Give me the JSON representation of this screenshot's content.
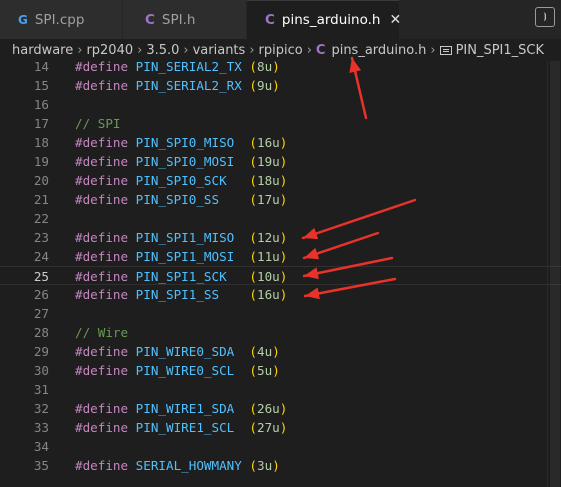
{
  "tabs": [
    {
      "label": "SPI.cpp",
      "icon": "G",
      "icon_name": "cpp-file-icon"
    },
    {
      "label": "SPI.h",
      "icon": "C",
      "icon_name": "c-header-file-icon"
    },
    {
      "label": "pins_arduino.h",
      "icon": "C",
      "icon_name": "c-header-file-icon",
      "active": true,
      "close_glyph": "✕"
    }
  ],
  "split_button": {
    "glyph": "⦘",
    "icon_name": "split-editor-icon"
  },
  "breadcrumb": {
    "parts": [
      "hardware",
      "rp2040",
      "3.5.0",
      "variants",
      "rpipico"
    ],
    "file": "pins_arduino.h",
    "file_icon": "C",
    "symbol": "PIN_SPI1_SCK",
    "separator": "›"
  },
  "code_lines": [
    {
      "n": "14",
      "kw": "#define",
      "id": "PIN_SERIAL2_TX",
      "gap": " ",
      "val": "8u"
    },
    {
      "n": "15",
      "kw": "#define",
      "id": "PIN_SERIAL2_RX",
      "gap": " ",
      "val": "9u"
    },
    {
      "n": "16"
    },
    {
      "n": "17",
      "comment": "// SPI"
    },
    {
      "n": "18",
      "kw": "#define",
      "id": "PIN_SPI0_MISO",
      "gap": "  ",
      "val": "16u"
    },
    {
      "n": "19",
      "kw": "#define",
      "id": "PIN_SPI0_MOSI",
      "gap": "  ",
      "val": "19u"
    },
    {
      "n": "20",
      "kw": "#define",
      "id": "PIN_SPI0_SCK",
      "gap": "   ",
      "val": "18u"
    },
    {
      "n": "21",
      "kw": "#define",
      "id": "PIN_SPI0_SS",
      "gap": "    ",
      "val": "17u"
    },
    {
      "n": "22"
    },
    {
      "n": "23",
      "kw": "#define",
      "id": "PIN_SPI1_MISO",
      "gap": "  ",
      "val": "12u"
    },
    {
      "n": "24",
      "kw": "#define",
      "id": "PIN_SPI1_MOSI",
      "gap": "  ",
      "val": "11u"
    },
    {
      "n": "25",
      "kw": "#define",
      "id": "PIN_SPI1_SCK",
      "gap": "   ",
      "val": "10u",
      "current": true
    },
    {
      "n": "26",
      "kw": "#define",
      "id": "PIN_SPI1_SS",
      "gap": "    ",
      "val": "16u"
    },
    {
      "n": "27"
    },
    {
      "n": "28",
      "comment": "// Wire"
    },
    {
      "n": "29",
      "kw": "#define",
      "id": "PIN_WIRE0_SDA",
      "gap": "  ",
      "val": "4u"
    },
    {
      "n": "30",
      "kw": "#define",
      "id": "PIN_WIRE0_SCL",
      "gap": "  ",
      "val": "5u"
    },
    {
      "n": "31"
    },
    {
      "n": "32",
      "kw": "#define",
      "id": "PIN_WIRE1_SDA",
      "gap": "  ",
      "val": "26u"
    },
    {
      "n": "33",
      "kw": "#define",
      "id": "PIN_WIRE1_SCL",
      "gap": "  ",
      "val": "27u"
    },
    {
      "n": "34"
    },
    {
      "n": "35",
      "kw": "#define",
      "id": "SERIAL_HOWMANY",
      "gap": " ",
      "val": "3u"
    }
  ],
  "annotation_color": "#e8322a"
}
